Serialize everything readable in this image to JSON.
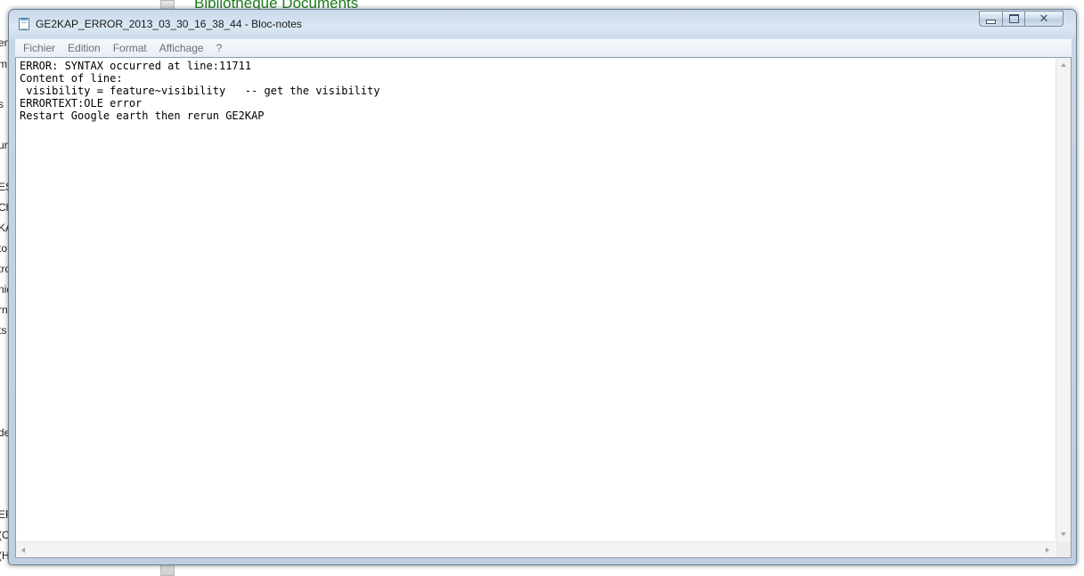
{
  "background": {
    "title": "Bibliothèque Documents",
    "fragments": [
      "en",
      "m",
      "s",
      "",
      "un",
      "l",
      "ES",
      "Ch",
      "KA",
      "to",
      "tro",
      "nic",
      "rn",
      "ts",
      "de",
      "EF",
      "(C",
      "(H"
    ]
  },
  "window": {
    "title": "GE2KAP_ERROR_2013_03_30_16_38_44 - Bloc-notes",
    "icon": "notepad-icon",
    "controls": {
      "minimize": "minimize-icon",
      "maximize": "maximize-icon",
      "close": "✕"
    }
  },
  "menu": {
    "items": [
      "Fichier",
      "Edition",
      "Format",
      "Affichage",
      "?"
    ]
  },
  "document": {
    "lines": [
      "ERROR: SYNTAX occurred at line:11711",
      "Content of line:",
      " visibility = feature~visibility   -- get the visibility",
      "ERRORTEXT:OLE error",
      "Restart Google earth then rerun GE2KAP"
    ]
  },
  "colors": {
    "background_title": "#1e7b1e",
    "menu_text": "#6f6f6f",
    "frame": "#c7d6e6"
  }
}
